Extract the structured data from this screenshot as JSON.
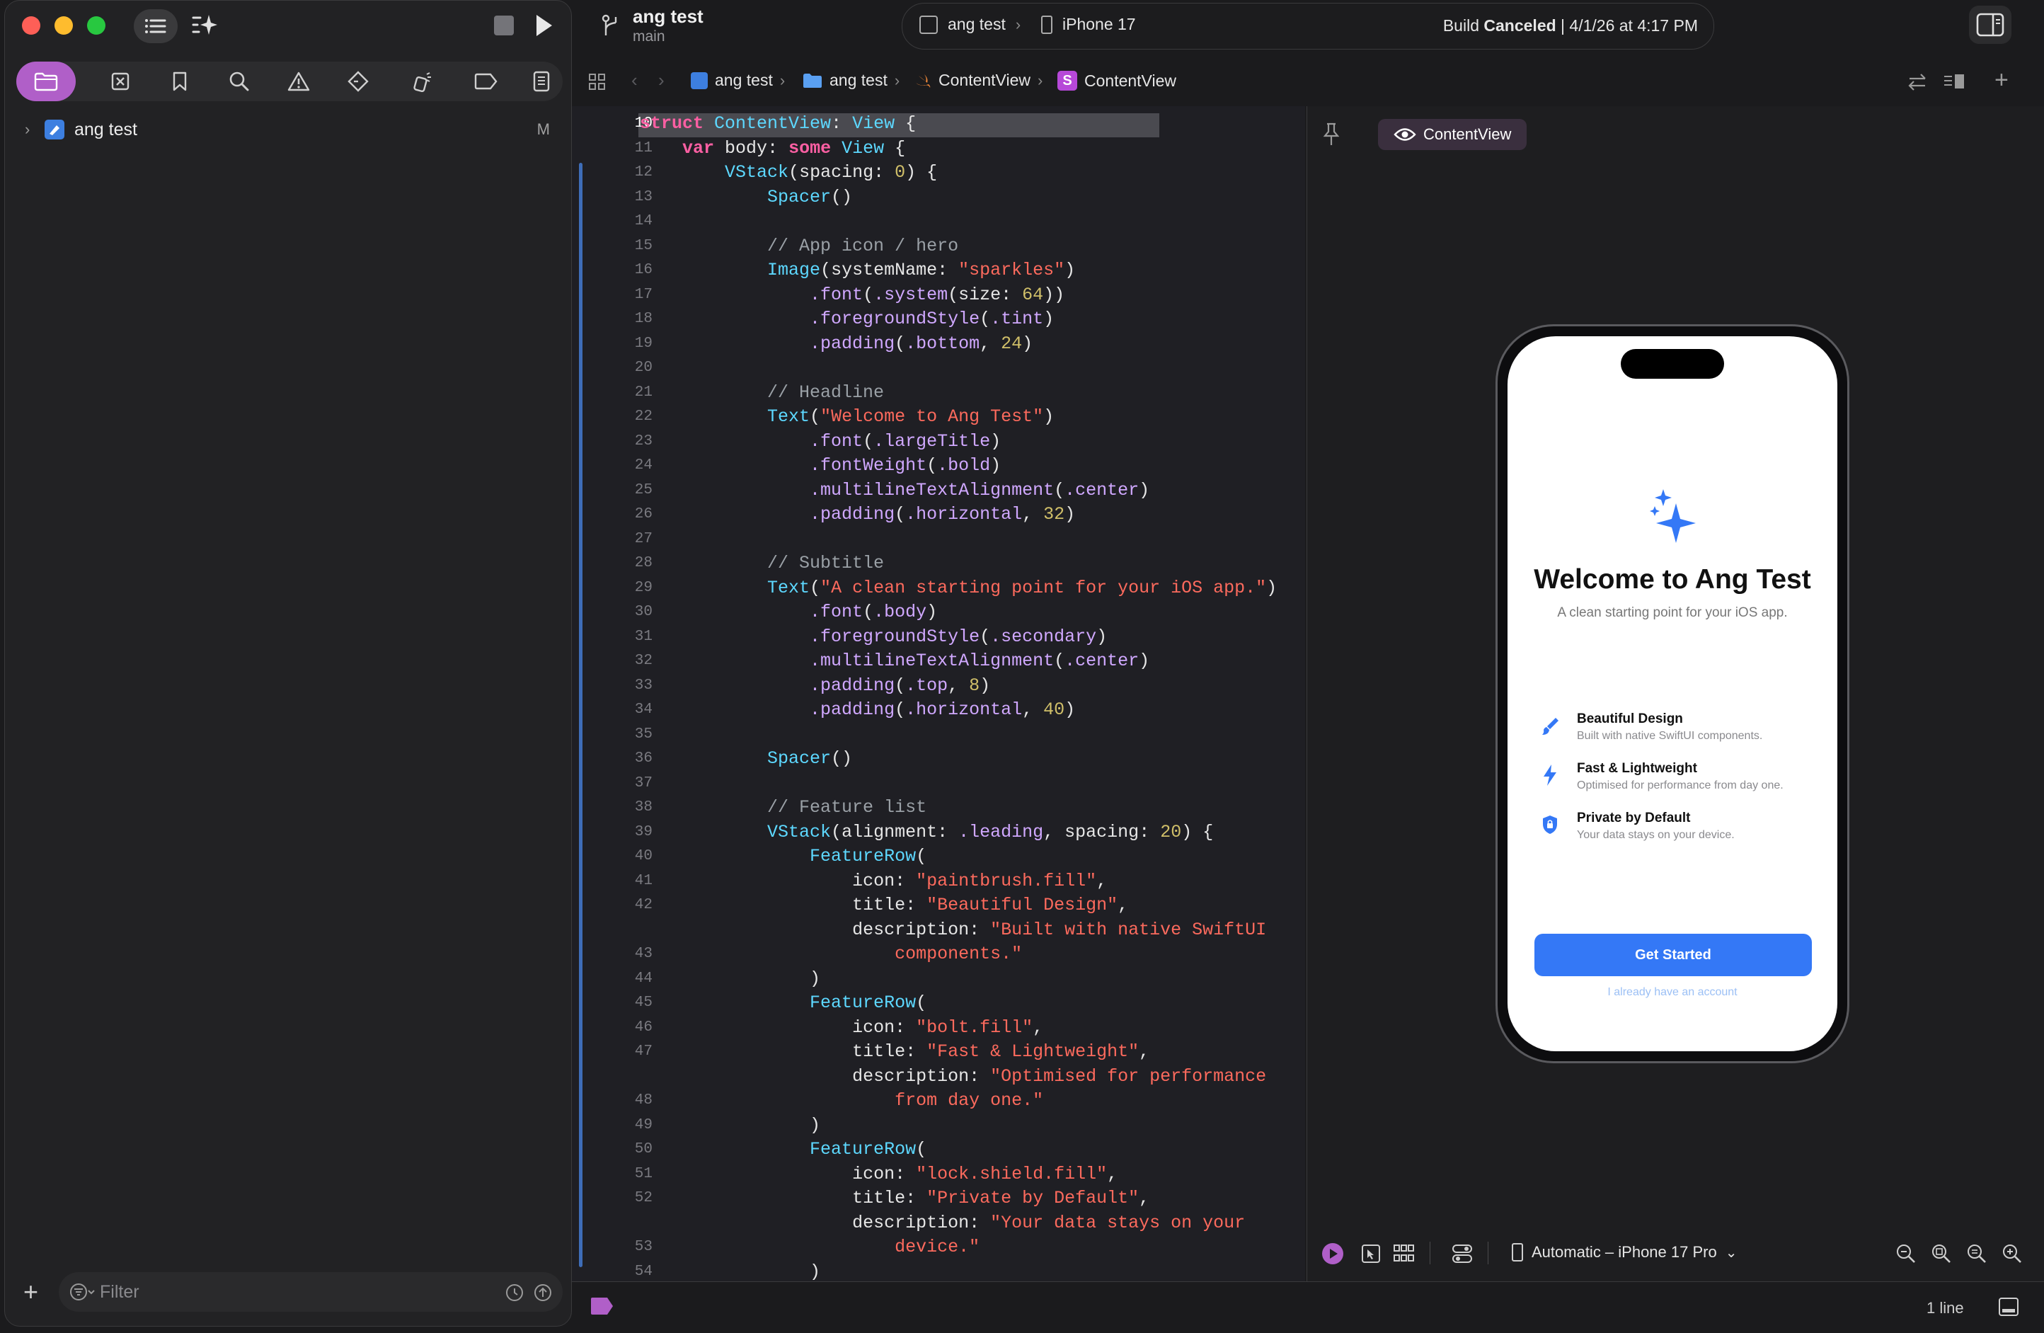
{
  "toolbar": {
    "project": "ang test",
    "branch": "main",
    "scheme": "ang test",
    "destination": "iPhone 17",
    "build_label": "Build",
    "build_status": "Canceled",
    "build_time": "4/1/26 at 4:17 PM"
  },
  "navigator": {
    "project_item": "ang test",
    "badge": "M",
    "filter_placeholder": "Filter"
  },
  "jumpbar": {
    "crumbs": [
      "ang test",
      "ang test",
      "ContentView",
      "ContentView"
    ]
  },
  "editor": {
    "line_numbers": [
      "10",
      "11",
      "12",
      "13",
      "14",
      "15",
      "16",
      "17",
      "18",
      "19",
      "20",
      "21",
      "22",
      "23",
      "24",
      "25",
      "26",
      "27",
      "28",
      "29",
      "30",
      "31",
      "32",
      "33",
      "34",
      "35",
      "36",
      "37",
      "38",
      "39",
      "40",
      "41",
      "42",
      "43",
      "44",
      "45",
      "46",
      "47",
      "48",
      "49",
      "50",
      "51",
      "52",
      "53",
      "54"
    ],
    "lines": [
      "struct ContentView: View {",
      "    var body: some View {",
      "        VStack(spacing: 0) {",
      "            Spacer()",
      "",
      "            // App icon / hero",
      "            Image(systemName: \"sparkles\")",
      "                .font(.system(size: 64))",
      "                .foregroundStyle(.tint)",
      "                .padding(.bottom, 24)",
      "",
      "            // Headline",
      "            Text(\"Welcome to Ang Test\")",
      "                .font(.largeTitle)",
      "                .fontWeight(.bold)",
      "                .multilineTextAlignment(.center)",
      "                .padding(.horizontal, 32)",
      "",
      "            // Subtitle",
      "            Text(\"A clean starting point for your iOS app.\")",
      "                .font(.body)",
      "                .foregroundStyle(.secondary)",
      "                .multilineTextAlignment(.center)",
      "                .padding(.top, 8)",
      "                .padding(.horizontal, 40)",
      "",
      "            Spacer()",
      "",
      "            // Feature list",
      "            VStack(alignment: .leading, spacing: 20) {",
      "                FeatureRow(",
      "                    icon: \"paintbrush.fill\",",
      "                    title: \"Beautiful Design\",",
      "                    description: \"Built with native SwiftUI",
      "                        components.\"",
      "                )",
      "                FeatureRow(",
      "                    icon: \"bolt.fill\",",
      "                    title: \"Fast & Lightweight\",",
      "                    description: \"Optimised for performance",
      "                        from day one.\"",
      "                )",
      "                FeatureRow(",
      "                    icon: \"lock.shield.fill\",",
      "                    title: \"Private by Default\",",
      "                    description: \"Your data stays on your",
      "                        device.\"",
      "                )"
    ]
  },
  "canvas": {
    "tag": "ContentView",
    "device_selector": "Automatic – iPhone 17 Pro",
    "app": {
      "headline": "Welcome to Ang Test",
      "subtitle": "A clean starting point for your iOS app.",
      "features": [
        {
          "title": "Beautiful Design",
          "description": "Built with native SwiftUI components."
        },
        {
          "title": "Fast & Lightweight",
          "description": "Optimised for performance from day one."
        },
        {
          "title": "Private by Default",
          "description": "Your data stays on your device."
        }
      ],
      "primary_button": "Get Started",
      "secondary_link": "I already have an account"
    }
  },
  "statusbar": {
    "line_count": "1 line"
  },
  "colors": {
    "accent": "#b05fc8",
    "ios_blue": "#3478f6",
    "background": "#1b1b1d"
  }
}
